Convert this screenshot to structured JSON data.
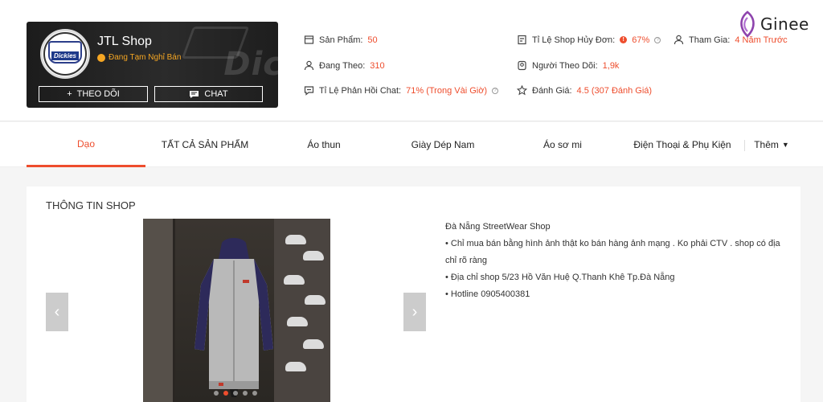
{
  "shop": {
    "name": "JTL Shop",
    "status": "Đang Tạm Nghỉ Bán",
    "logo_text": "Dickies",
    "bg_text": "Dic",
    "follow_label": "THEO DÕI",
    "chat_label": "CHAT"
  },
  "stats": {
    "products": {
      "label": "Sản Phẩm:",
      "value": "50"
    },
    "following": {
      "label": "Đang Theo:",
      "value": "310"
    },
    "chat_response": {
      "label": "Tỉ Lệ Phản Hồi Chat:",
      "value": "71% (Trong Vài Giờ)"
    },
    "cancel_rate": {
      "label": "Tỉ Lệ Shop Hủy Đơn:",
      "value": "67%"
    },
    "followers": {
      "label": "Người Theo Dõi:",
      "value": "1,9k"
    },
    "rating": {
      "label": "Đánh Giá:",
      "value": "4.5 (307 Đánh Giá)"
    },
    "joined": {
      "label": "Tham Gia:",
      "value": "4 Năm Trước"
    }
  },
  "watermark": "Ginee",
  "tabs": [
    {
      "label": "Dạo"
    },
    {
      "label": "TẤT CẢ SẢN PHẨM"
    },
    {
      "label": "Áo thun"
    },
    {
      "label": "Giày Dép Nam"
    },
    {
      "label": "Áo sơ mi"
    },
    {
      "label": "Điện Thoại & Phụ Kiện"
    },
    {
      "label": "Thêm"
    }
  ],
  "info": {
    "title": "THÔNG TIN SHOP",
    "lines": [
      "Đà Nẵng StreetWear Shop",
      "• Chỉ mua bán bằng hình ảnh thật ko bán hàng ảnh mạng . Ko phải CTV . shop có địa chỉ rõ ràng",
      "• Địa chỉ shop 5/23 Hồ Văn Huệ Q.Thanh Khê Tp.Đà Nẵng",
      "• Hotline 0905400381"
    ]
  },
  "colors": {
    "accent": "#ee4d2d",
    "status": "#f5a623",
    "ginee_purple": "#8e44ad"
  }
}
